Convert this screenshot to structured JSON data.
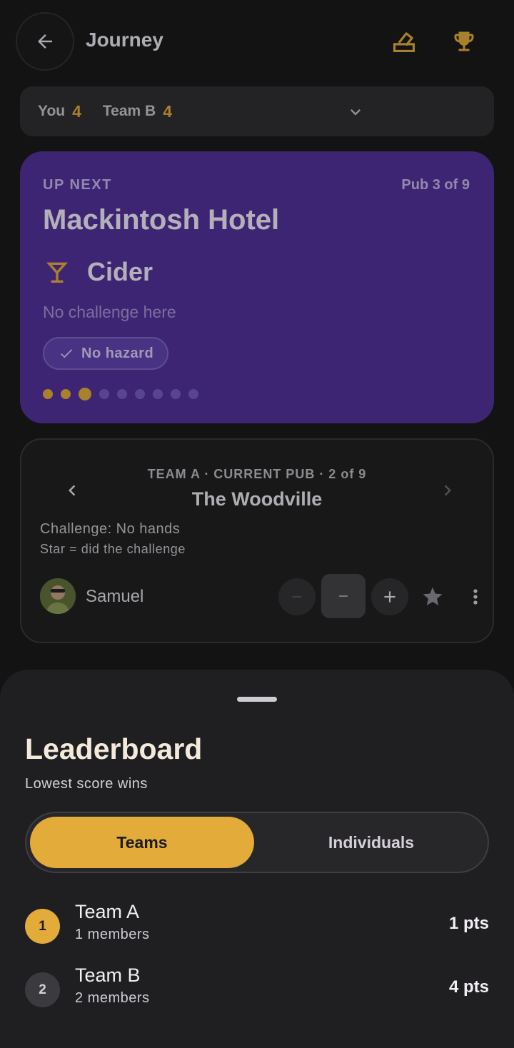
{
  "header": {
    "title": "Journey"
  },
  "scorebar": {
    "you_label": "You",
    "you_score": "4",
    "team_label": "Team B",
    "team_score": "4"
  },
  "up_next": {
    "label": "UP NEXT",
    "pub_count": "Pub 3 of 9",
    "pub_name": "Mackintosh Hotel",
    "drink": "Cider",
    "challenge": "No challenge here",
    "hazard": "No hazard",
    "progress": {
      "total": 9,
      "completed": 2,
      "current": 3
    }
  },
  "current_pub": {
    "label": "TEAM A · CURRENT PUB · 2 of 9",
    "name": "The Woodville",
    "challenge": "Challenge: No hands",
    "star_hint": "Star = did the challenge",
    "member": {
      "name": "Samuel"
    }
  },
  "leaderboard": {
    "title": "Leaderboard",
    "subtitle": "Lowest score wins",
    "tabs": {
      "active": "Teams",
      "inactive": "Individuals"
    },
    "rows": [
      {
        "rank": "1",
        "name": "Team A",
        "members": "1 members",
        "points": "1 pts"
      },
      {
        "rank": "2",
        "name": "Team B",
        "members": "2 members",
        "points": "4 pts"
      }
    ]
  },
  "colors": {
    "accent": "#e3ac33",
    "card_purple": "#4f2d9a",
    "background": "#131314"
  }
}
